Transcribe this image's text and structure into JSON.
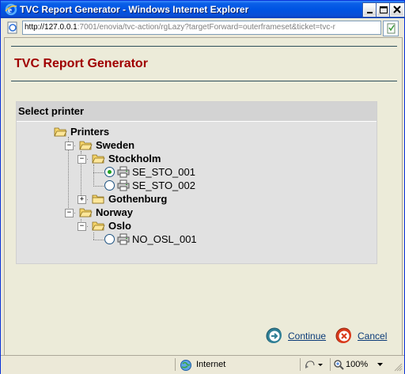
{
  "window": {
    "title": "TVC Report Generator - Windows Internet Explorer"
  },
  "address": {
    "host": "http://127.0.0.1",
    "rest": ":7001/enovia/tvc-action/rgLazy?targetForward=outerframeset&ticket=tvc-r"
  },
  "page": {
    "title": "TVC Report Generator",
    "section_title": "Select printer"
  },
  "tree": {
    "root": {
      "label": "Printers",
      "expanded": true
    },
    "sweden": {
      "label": "Sweden",
      "expanded": true
    },
    "stockholm": {
      "label": "Stockholm",
      "expanded": true
    },
    "se_sto_001": {
      "label": "SE_STO_001",
      "selected": true
    },
    "se_sto_002": {
      "label": "SE_STO_002",
      "selected": false
    },
    "gothenburg": {
      "label": "Gothenburg",
      "expanded": false
    },
    "norway": {
      "label": "Norway",
      "expanded": true
    },
    "oslo": {
      "label": "Oslo",
      "expanded": true
    },
    "no_osl_001": {
      "label": "NO_OSL_001",
      "selected": false
    }
  },
  "buttons": {
    "continue": "Continue",
    "cancel": "Cancel"
  },
  "status": {
    "zone": "Internet",
    "zoom": "100%"
  },
  "colors": {
    "title_red": "#a00000",
    "continue_teal": "#2f7f95",
    "cancel_red": "#d93a1b"
  }
}
